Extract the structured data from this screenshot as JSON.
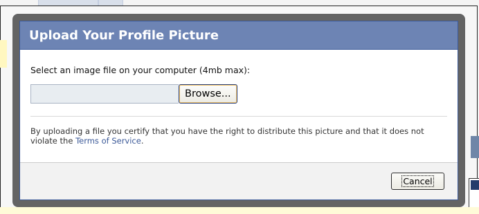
{
  "dialog": {
    "title": "Upload Your Profile Picture",
    "instruction": "Select an image file on your computer (4mb max):",
    "file_input_value": "",
    "browse_label": "Browse...",
    "terms_text": "By uploading a file you certify that you have the right to distribute this picture and that it does not violate the",
    "terms_link": "Terms of Service",
    "terms_suffix": ".",
    "cancel_label": "Cancel"
  },
  "colors": {
    "header_bg": "#6d84b4",
    "link": "#3b5998",
    "shadow": "#575757"
  }
}
